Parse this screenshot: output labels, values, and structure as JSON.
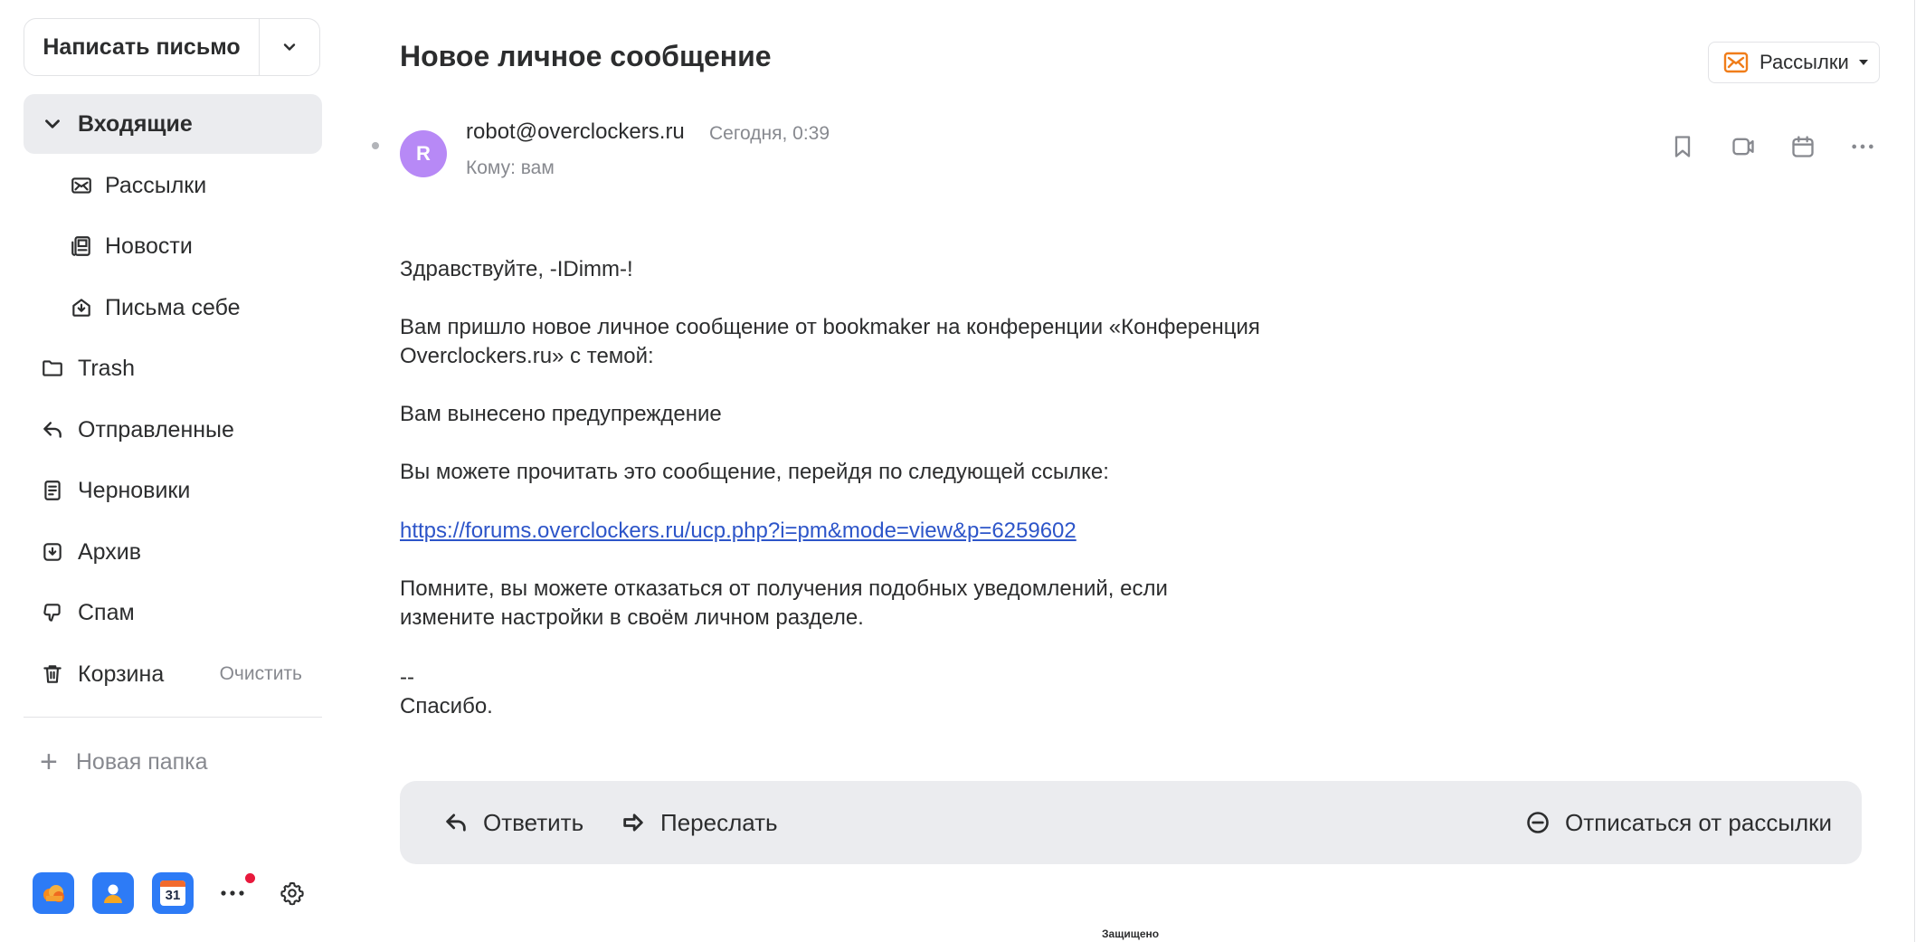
{
  "sidebar": {
    "compose_label": "Написать письмо",
    "items": [
      {
        "label": "Входящие",
        "icon": "chevron-down-icon"
      },
      {
        "label": "Рассылки",
        "icon": "newsletter-icon"
      },
      {
        "label": "Новости",
        "icon": "news-icon"
      },
      {
        "label": "Письма себе",
        "icon": "self-letters-icon"
      },
      {
        "label": "Trash",
        "icon": "folder-icon"
      },
      {
        "label": "Отправленные",
        "icon": "sent-icon"
      },
      {
        "label": "Черновики",
        "icon": "drafts-icon"
      },
      {
        "label": "Архив",
        "icon": "archive-icon"
      },
      {
        "label": "Спам",
        "icon": "spam-icon"
      },
      {
        "label": "Корзина",
        "icon": "trash-icon"
      }
    ],
    "clear_label": "Очистить",
    "new_folder_label": "Новая папка",
    "calendar_day": "31"
  },
  "message": {
    "subject": "Новое личное сообщение",
    "label_button": "Рассылки",
    "avatar_letter": "R",
    "sender": "robot@overclockers.ru",
    "date": "Сегодня, 0:39",
    "to": "Кому: вам",
    "greeting": "Здравствуйте, -IDimm-!",
    "para1_line1": "Вам пришло новое личное сообщение от bookmaker на конференции «Конференция",
    "para1_line2": "Overclockers.ru» с темой:",
    "topic": "Вам вынесено предупреждение",
    "para2": "Вы можете прочитать это сообщение, перейдя по следующей ссылке:",
    "link": "https://forums.overclockers.ru/ucp.php?i=pm&mode=view&p=6259602",
    "para3_line1": "Помните, вы можете отказаться от получения подобных уведомлений, если",
    "para3_line2": "измените настройки в своём личном разделе.",
    "sig_dash": "--",
    "sig_thanks": "Спасибо."
  },
  "actions": {
    "reply": "Ответить",
    "forward": "Переслать",
    "unsubscribe": "Отписаться от рассылки"
  },
  "status": {
    "protected": "Защищено"
  },
  "colors": {
    "accent_link": "#2d55c9",
    "avatar": "#b789f6",
    "active_bg": "#ebecef",
    "newsletter_orange": "#f07d1a"
  }
}
